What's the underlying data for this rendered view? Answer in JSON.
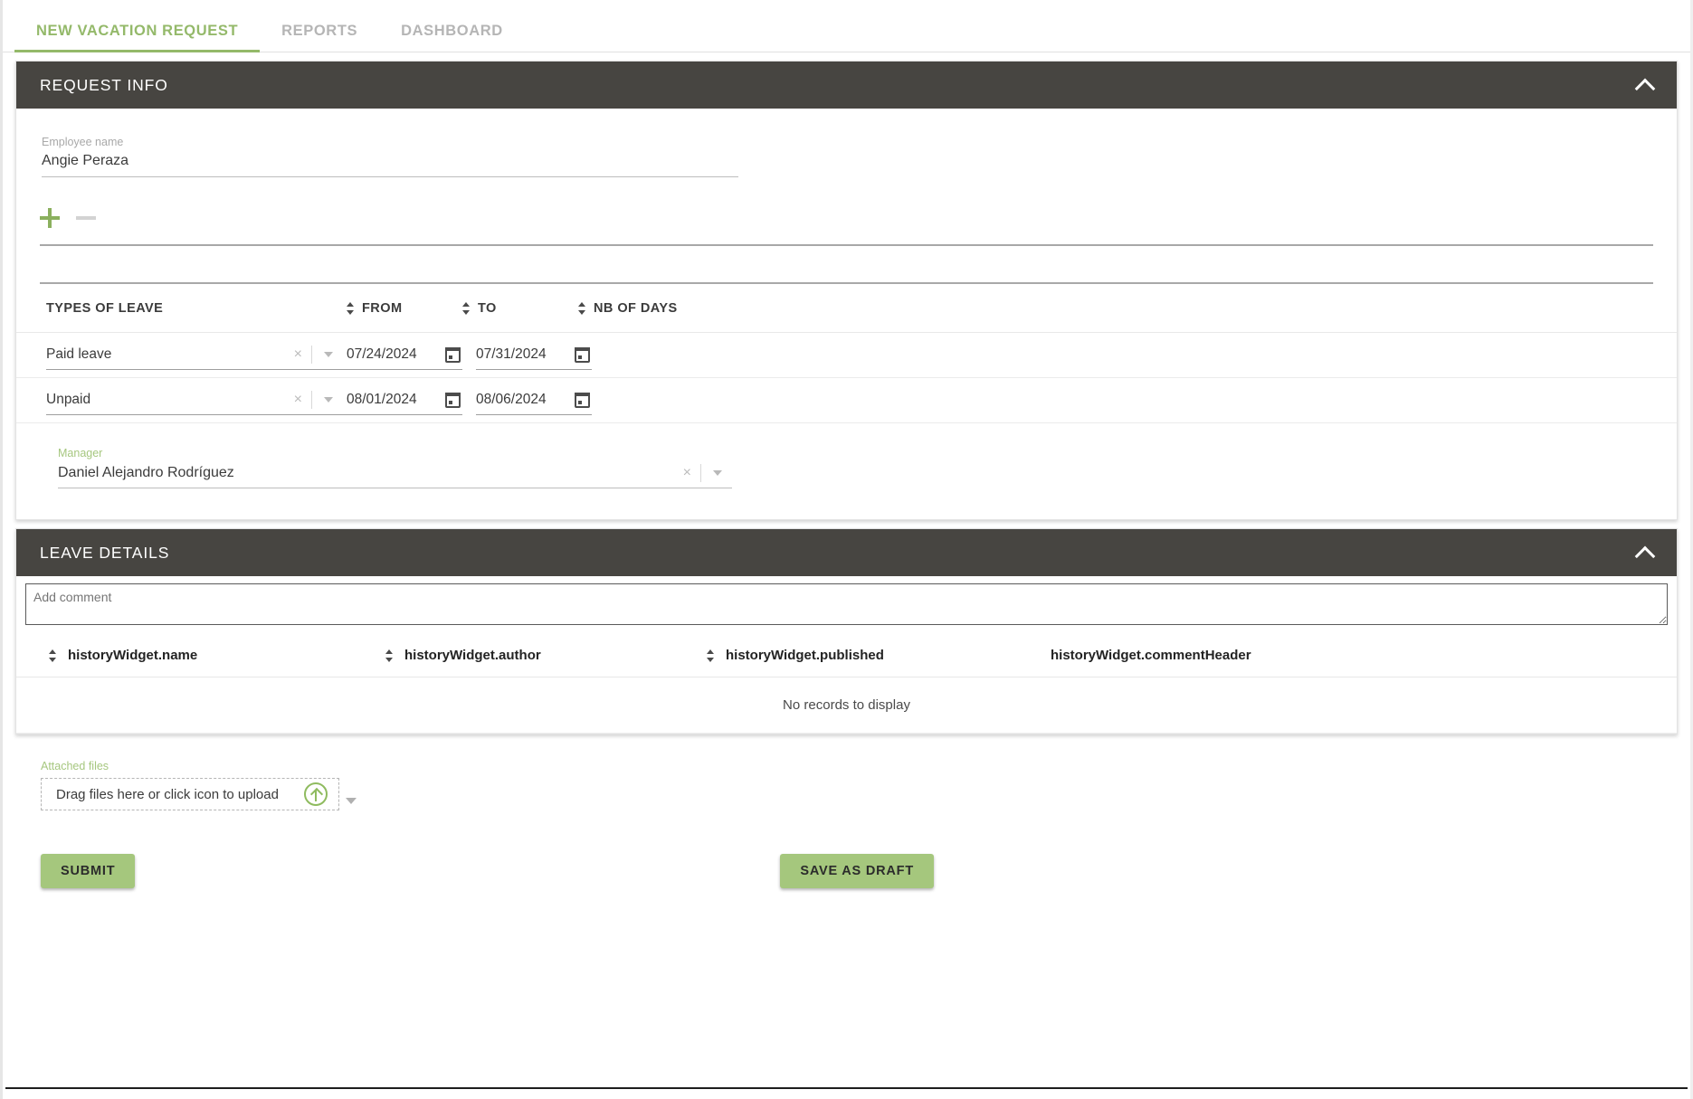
{
  "tabs": [
    {
      "label": "NEW VACATION REQUEST",
      "active": true
    },
    {
      "label": "REPORTS",
      "active": false
    },
    {
      "label": "DASHBOARD",
      "active": false
    }
  ],
  "request_info": {
    "title": "REQUEST INFO",
    "collapse_icon": "chevron-up-icon",
    "employee": {
      "label": "Employee name",
      "value": "Angie Peraza"
    },
    "add_label": "+",
    "remove_label": "–",
    "leave_table": {
      "headers": {
        "types": "TYPES OF LEAVE",
        "from": "FROM",
        "to": "TO",
        "days": "NB OF DAYS"
      },
      "rows": [
        {
          "type": "Paid leave",
          "from": "07/24/2024",
          "to": "07/31/2024",
          "days": ""
        },
        {
          "type": "Unpaid",
          "from": "08/01/2024",
          "to": "08/06/2024",
          "days": ""
        }
      ],
      "clear_icon": "×"
    },
    "manager": {
      "label": "Manager",
      "value": "Daniel Alejandro Rodríguez",
      "clear_icon": "×"
    }
  },
  "leave_details": {
    "title": "LEAVE DETAILS",
    "collapse_icon": "chevron-up-icon",
    "comment": {
      "placeholder": "Add comment",
      "value": ""
    },
    "history": {
      "headers": [
        "historyWidget.name",
        "historyWidget.author",
        "historyWidget.published",
        "historyWidget.commentHeader"
      ],
      "empty_message": "No records to display"
    }
  },
  "attachments": {
    "label": "Attached files",
    "dropzone_text": "Drag files here or click icon to upload",
    "upload_icon": "upload-arrow-icon"
  },
  "actions": {
    "submit": "SUBMIT",
    "save_draft": "SAVE AS DRAFT"
  },
  "colors": {
    "accent_green": "#94b96a",
    "button_green": "#a5c77d",
    "header_dark": "#474541"
  }
}
